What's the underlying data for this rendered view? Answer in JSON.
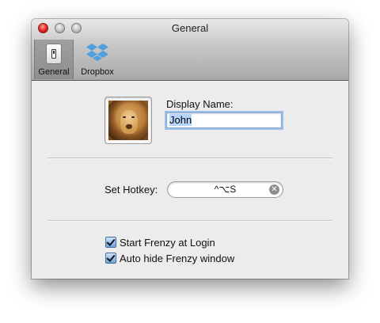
{
  "window": {
    "title": "General"
  },
  "toolbar": {
    "items": [
      {
        "label": "General",
        "icon": "switch-icon",
        "selected": true
      },
      {
        "label": "Dropbox",
        "icon": "dropbox-icon",
        "selected": false
      }
    ]
  },
  "profile": {
    "avatar": "lion-avatar",
    "display_name_label": "Display Name:",
    "display_name_value": "John"
  },
  "hotkey": {
    "label": "Set Hotkey:",
    "value": "^⌥S"
  },
  "options": [
    {
      "label": "Start Frenzy at Login",
      "checked": true
    },
    {
      "label": "Auto hide Frenzy window",
      "checked": true
    }
  ]
}
